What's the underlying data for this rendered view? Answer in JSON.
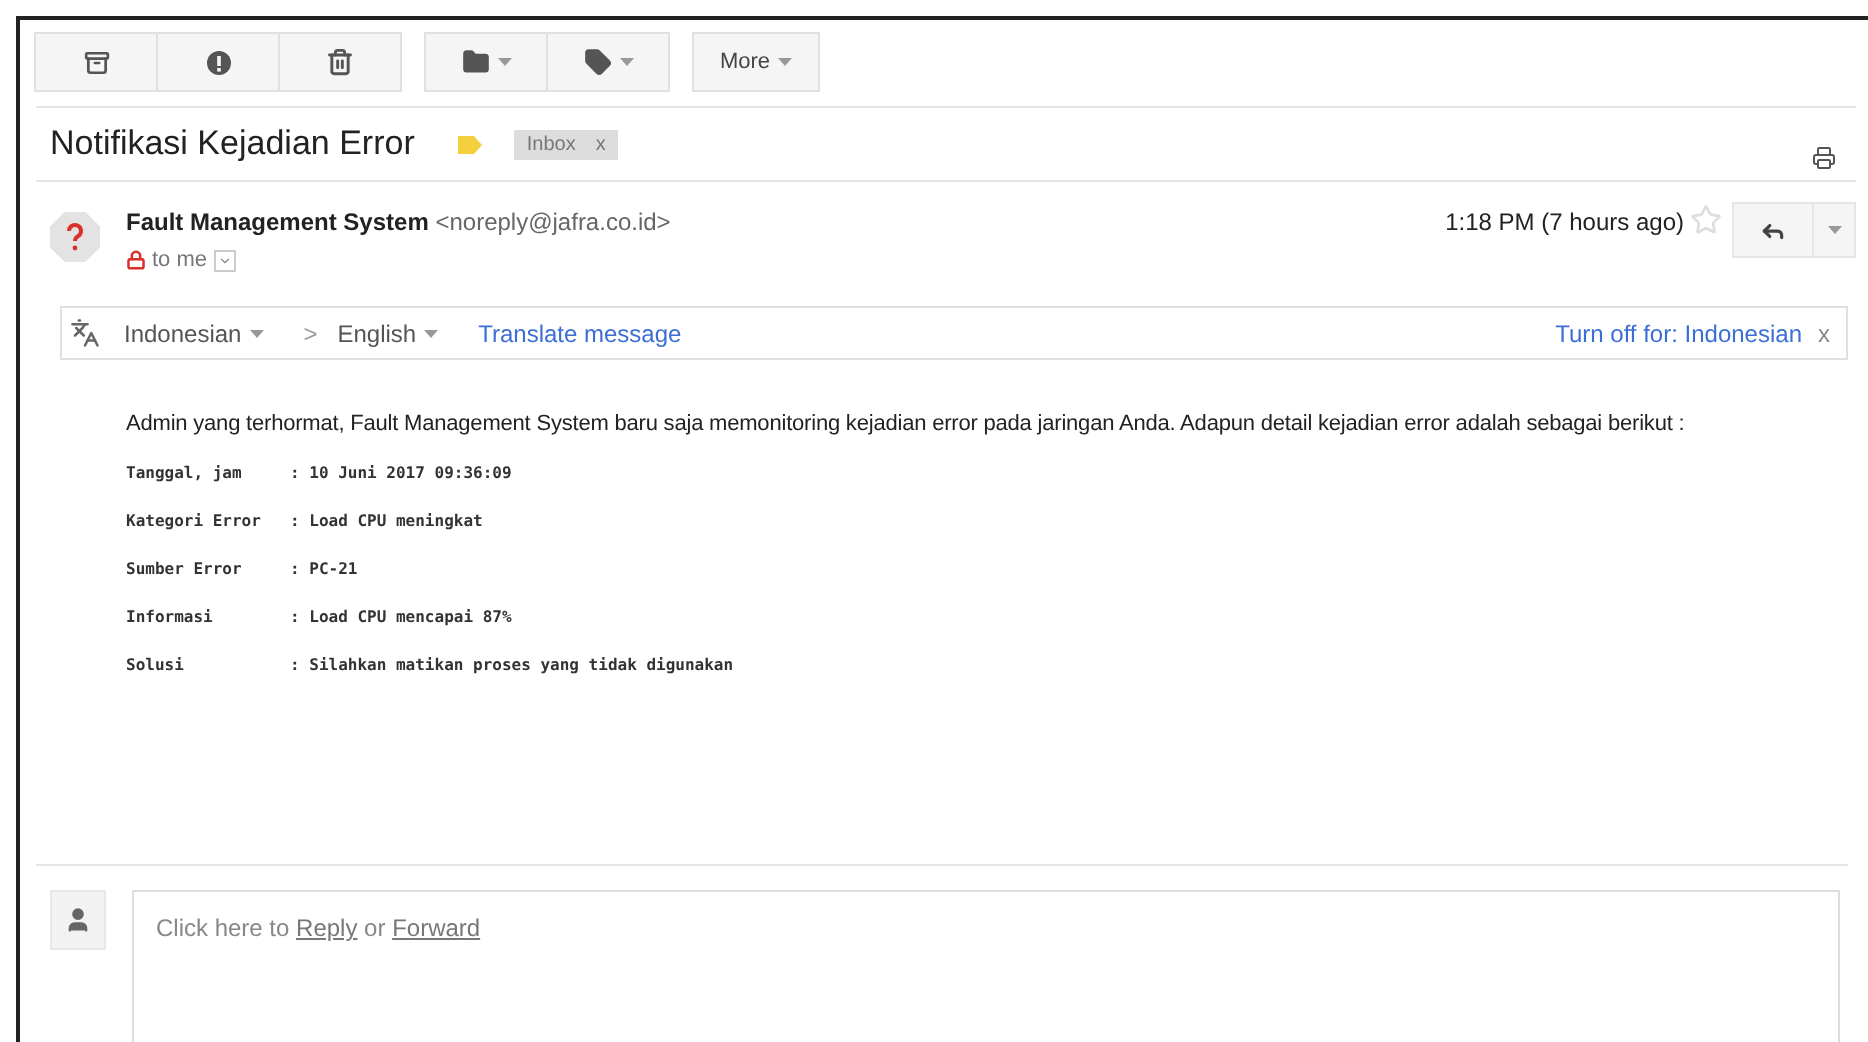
{
  "toolbar": {
    "more_label": "More"
  },
  "subject": {
    "title": "Notifikasi Kejadian Error",
    "labels": [
      {
        "name": "Inbox",
        "close": "x"
      }
    ]
  },
  "message": {
    "sender_name": "Fault Management System",
    "sender_email": "<noreply@jafra.co.id>",
    "recipient": "to me",
    "time": "1:18 PM (7 hours ago)",
    "starred": false
  },
  "translate_bar": {
    "source": "Indonesian",
    "arrow": ">",
    "target": "English",
    "action": "Translate message",
    "turn_off": "Turn off for: Indonesian",
    "close": "x"
  },
  "body": {
    "intro": "Admin yang terhormat, Fault Management System baru saja memonitoring kejadian error pada jaringan Anda. Adapun detail kejadian error adalah sebagai berikut :",
    "fields": [
      {
        "label": "Tanggal, jam",
        "value": ": 10 Juni 2017 09:36:09"
      },
      {
        "label": "Kategori Error",
        "value": ": Load CPU meningkat"
      },
      {
        "label": "Sumber Error",
        "value": ": PC-21"
      },
      {
        "label": "Informasi",
        "value": ": Load CPU mencapai 87%"
      },
      {
        "label": "Solusi",
        "value": ": Silahkan matikan proses yang tidak digunakan"
      }
    ]
  },
  "reply_box": {
    "parts": [
      {
        "kind": "text",
        "text": "Click here to "
      },
      {
        "kind": "link",
        "text": "Reply"
      },
      {
        "kind": "text",
        "text": " or "
      },
      {
        "kind": "link",
        "text": "Forward"
      }
    ]
  }
}
